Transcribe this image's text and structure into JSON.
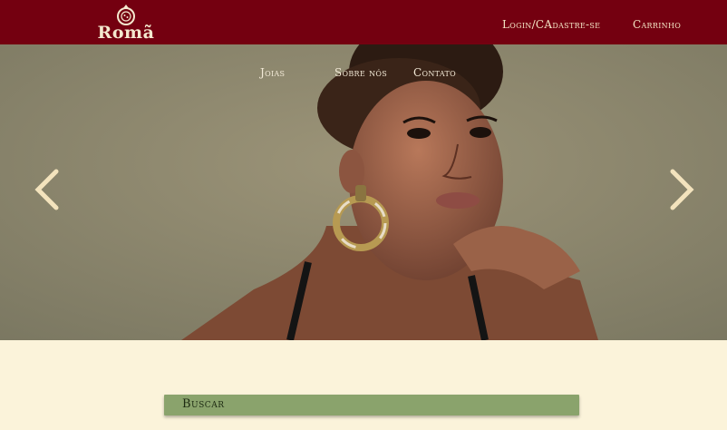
{
  "header": {
    "logo_text": "Romã",
    "login_label": "Login/CAdastre-se",
    "cart_label": "Carrinho",
    "bg_color": "#740010"
  },
  "nav": {
    "items": [
      {
        "label": "Joias"
      },
      {
        "label": "Sobre nós"
      },
      {
        "label": "Contato"
      }
    ]
  },
  "carousel": {
    "prev_icon": "chevron-left-icon",
    "next_icon": "chevron-right-icon",
    "arrow_color": "#f3e3bd"
  },
  "search": {
    "label": "Buscar",
    "bg_color": "#8aa36c"
  },
  "page": {
    "bg_color": "#fbf3da"
  }
}
